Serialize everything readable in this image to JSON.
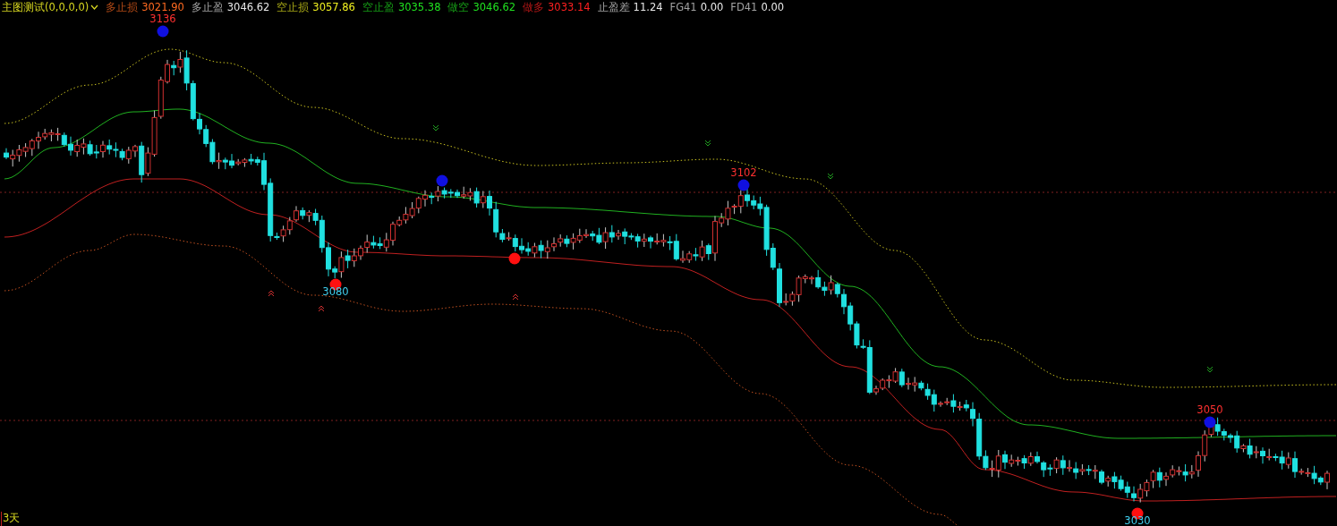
{
  "header": {
    "title": "主图测试(0,0,0,0)",
    "indicators": [
      {
        "label": "多止损",
        "value": "3021.90",
        "color": "#ff6a20"
      },
      {
        "label": "多止盈",
        "value": "3046.62",
        "color": "#e8e8e8"
      },
      {
        "label": "空止损",
        "value": "3057.86",
        "color": "#f0f020"
      },
      {
        "label": "空止盈",
        "value": "3035.38",
        "color": "#20e020"
      },
      {
        "label": "做空",
        "value": "3046.62",
        "color": "#20e020"
      },
      {
        "label": "做多",
        "value": "3033.14",
        "color": "#ff2020"
      },
      {
        "label": "止盈差",
        "value": "11.24",
        "color": "#e8e8e8"
      },
      {
        "label": "FG41",
        "value": "0.00",
        "color": "#e8e8e8"
      },
      {
        "label": "FD41",
        "value": "0.00",
        "color": "#e8e8e8"
      }
    ]
  },
  "chart": {
    "extremes": [
      {
        "kind": "high",
        "label": "3136"
      },
      {
        "kind": "low",
        "label": "3080"
      },
      {
        "kind": "high"
      },
      {
        "kind": "low"
      },
      {
        "kind": "high",
        "label": "3102"
      },
      {
        "kind": "low",
        "label": "3030"
      },
      {
        "kind": "high",
        "label": "3050"
      }
    ],
    "period_label": "3天"
  }
}
